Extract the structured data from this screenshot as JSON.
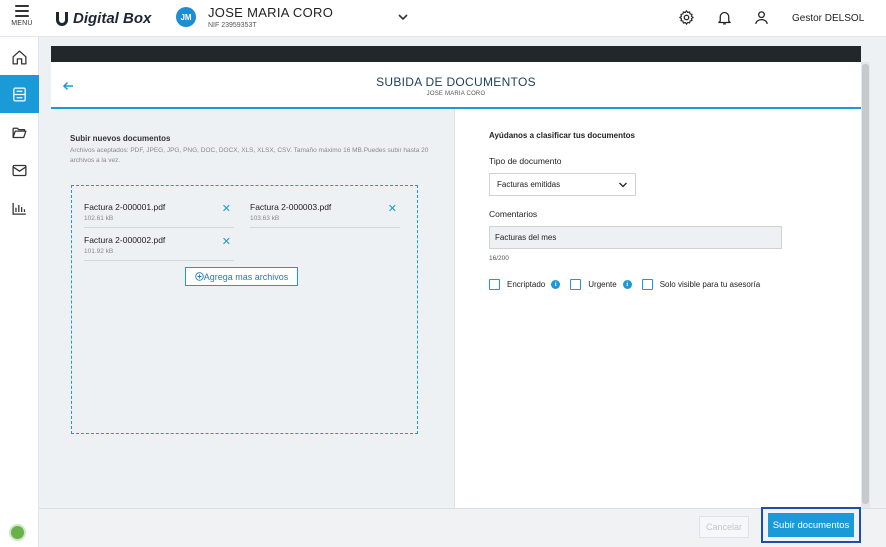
{
  "header": {
    "menu_label": "MENÚ",
    "logo_text": "Digital Box",
    "client": {
      "initials": "JM",
      "name": "JOSE MARIA CORO",
      "nif": "NIF 23959353T"
    },
    "user_label": "Gestor DELSOL",
    "icons": [
      "gear-icon",
      "bell-icon",
      "user-icon",
      "chevron-down-icon"
    ]
  },
  "sidebar": {
    "items": [
      {
        "icon": "home-icon",
        "active": false
      },
      {
        "icon": "inbox-icon",
        "active": true
      },
      {
        "icon": "folder-open-icon",
        "active": false
      },
      {
        "icon": "mail-icon",
        "active": false
      },
      {
        "icon": "bar-chart-icon",
        "active": false
      }
    ]
  },
  "page": {
    "title": "SUBIDA DE DOCUMENTOS",
    "subtitle": "JOSE MARIA CORO"
  },
  "upload": {
    "title": "Subir nuevos documentos",
    "hint": "Archivos aceptados: PDF, JPEG, JPG, PNG, DOC, DOCX, XLS, XLSX, CSV. Tamaño máximo 16 MB.Puedes subir hasta 20 archivos a la vez.",
    "files": [
      {
        "name": "Factura 2-000001.pdf",
        "size": "102.61 kB"
      },
      {
        "name": "Factura 2-000003.pdf",
        "size": "103.63 kB"
      },
      {
        "name": "Factura 2-000002.pdf",
        "size": "101.92 kB"
      }
    ],
    "remove_symbol": "✕",
    "add_more_label": "Agrega mas archivos"
  },
  "classify": {
    "title": "Ayúdanos a clasificar tus documentos",
    "doc_type_label": "Tipo de documento",
    "doc_type_value": "Facturas emitidas",
    "comments_label": "Comentarios",
    "comments_value": "Facturas del mes",
    "counter": "16/200",
    "checks": [
      {
        "label": "Encriptado",
        "info": true,
        "checked": false
      },
      {
        "label": "Urgente",
        "info": true,
        "checked": false
      },
      {
        "label": "Solo visible para tu asesoría",
        "info": false,
        "checked": false
      }
    ],
    "info_symbol": "i"
  },
  "footer": {
    "cancel_label": "Cancelar",
    "submit_label": "Subir documentos"
  },
  "colors": {
    "accent": "#1a9ad6",
    "highlight_border": "#1d4ea8",
    "dark_band": "#22272b"
  }
}
